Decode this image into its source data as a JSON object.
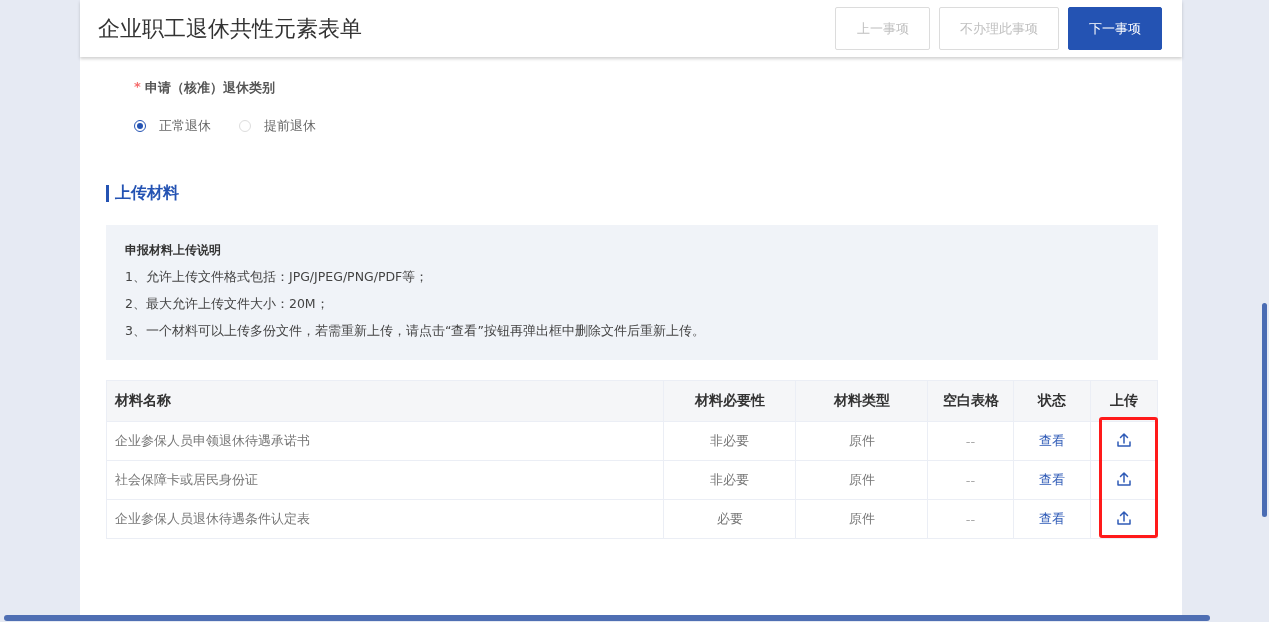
{
  "header": {
    "title": "企业职工退休共性元素表单",
    "buttons": [
      {
        "label": "上一事项",
        "kind": "default",
        "disabled": true
      },
      {
        "label": "不办理此事项",
        "kind": "default",
        "disabled": true
      },
      {
        "label": "下一事项",
        "kind": "primary",
        "disabled": false
      }
    ]
  },
  "retirement_type": {
    "label": "申请（核准）退休类别",
    "required_mark": "*",
    "options": [
      {
        "label": "正常退休",
        "selected": true
      },
      {
        "label": "提前退休",
        "selected": false
      }
    ]
  },
  "upload_section": {
    "title": "上传材料",
    "notice": {
      "title": "申报材料上传说明",
      "lines": [
        "1、允许上传文件格式包括：JPG/JPEG/PNG/PDF等；",
        "2、最大允许上传文件大小：20M；",
        "3、一个材料可以上传多份文件，若需重新上传，请点击“查看”按钮再弹出框中删除文件后重新上传。"
      ]
    },
    "table": {
      "columns": [
        "材料名称",
        "材料必要性",
        "材料类型",
        "空白表格",
        "状态",
        "上传"
      ],
      "rows": [
        {
          "name": "企业参保人员申领退休待遇承诺书",
          "necessity": "非必要",
          "type": "原件",
          "blank_form": "--",
          "status": "查看"
        },
        {
          "name": "社会保障卡或居民身份证",
          "necessity": "非必要",
          "type": "原件",
          "blank_form": "--",
          "status": "查看"
        },
        {
          "name": "企业参保人员退休待遇条件认定表",
          "necessity": "必要",
          "type": "原件",
          "blank_form": "--",
          "status": "查看"
        }
      ],
      "upload_column_highlighted": true
    }
  }
}
